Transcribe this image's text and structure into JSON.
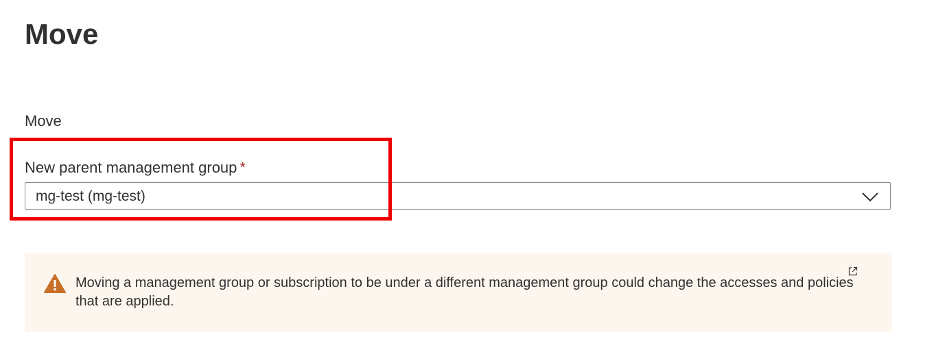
{
  "page": {
    "title": "Move"
  },
  "form": {
    "section_label": "Move",
    "parent_group": {
      "label": "New parent management group",
      "required_marker": "*",
      "selected_value": "mg-test (mg-test)",
      "chevron_icon": "chevron-down-icon"
    }
  },
  "warning": {
    "icon": "warning-icon",
    "message": "Moving a management group or subscription to be under a different management group could change the accesses and policies that are applied.",
    "link_icon": "external-link-icon"
  },
  "colors": {
    "highlight": "#ee0000",
    "required": "#a4262c",
    "warning_icon": "#c8702a",
    "warning_background": "#fdf6ef"
  }
}
